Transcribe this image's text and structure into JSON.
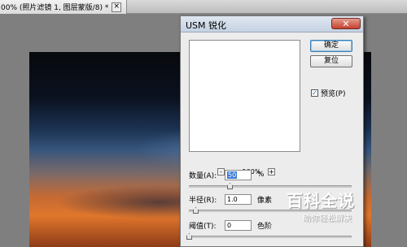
{
  "tab": {
    "title": "00% (照片滤镜 1, 图层蒙版/8) *",
    "close_glyph": "×"
  },
  "dialog": {
    "title": "USM 锐化",
    "close_glyph": "✕",
    "zoom": {
      "minus": "-",
      "plus": "+",
      "value": "100%"
    },
    "buttons": {
      "ok": "确定",
      "reset": "复位"
    },
    "preview": {
      "label": "预览(P)",
      "checked": true,
      "check_glyph": "✓"
    },
    "fields": {
      "amount": {
        "label": "数量(A):",
        "value": "50",
        "unit": "%",
        "slider_fraction": 0.25
      },
      "radius": {
        "label": "半径(R):",
        "value": "1.0",
        "unit": "像素",
        "slider_fraction": 0.04
      },
      "threshold": {
        "label": "阈值(T):",
        "value": "0",
        "unit": "色阶",
        "slider_fraction": 0.0
      }
    }
  },
  "watermark": {
    "title": "百科全说",
    "subtitle": "助你轻松解决"
  }
}
